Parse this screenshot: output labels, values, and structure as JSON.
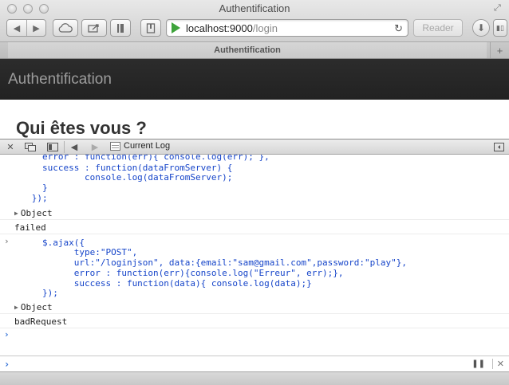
{
  "window": {
    "title": "Authentification"
  },
  "toolbar": {
    "url_host": "localhost:9000",
    "url_path": "/login",
    "reader_label": "Reader"
  },
  "tab": {
    "label": "Authentification"
  },
  "page": {
    "brand": "Authentification",
    "heading": "Qui êtes vous ?"
  },
  "inspector": {
    "log_title": "Current Log"
  },
  "console": {
    "lines": [
      "        error : function(err){ console.log(err); },",
      "        success : function(dataFromServer) {",
      "                console.log(dataFromServer);",
      "        }",
      "      });",
      "Object",
      "failed",
      "        $.ajax({",
      "              type:\"POST\",",
      "              url:\"/loginjson\", data:{email:\"sam@gmail.com\",password:\"play\"},",
      "              error : function(err){console.log(\"Erreur\", err);},",
      "              success : function(data){ console.log(data);}",
      "        });",
      "Object",
      "badRequest"
    ]
  },
  "colors": {
    "code_text": "#1544c9",
    "prompt": "#2f6fd6",
    "header_bg": "#222222",
    "play_icon": "#3ea33b"
  }
}
